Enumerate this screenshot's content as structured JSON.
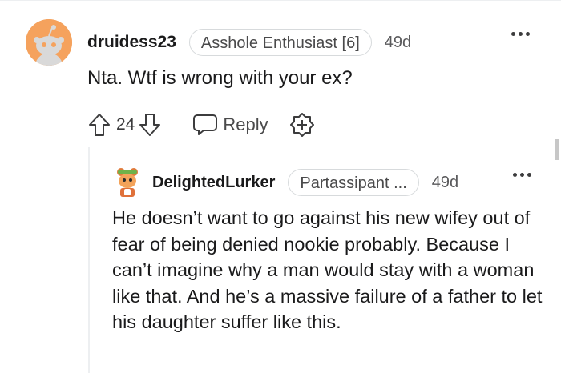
{
  "comments": [
    {
      "username": "druidess23",
      "flair": "Asshole Enthusiast [6]",
      "time": "49d",
      "body": "Nta. Wtf is wrong with your ex?",
      "votes": "24",
      "reply_label": "Reply",
      "avatar_color": "#f5a25d"
    },
    {
      "username": "DelightedLurker",
      "flair": "Partassipant ...",
      "time": "49d",
      "body": "He doesn’t want to go against his new wifey out of fear of being denied nookie probably. Because I can’t imagine why a man would stay with a woman like that. And he’s a massive failure of a father to let his daughter suffer like this."
    }
  ],
  "icons": {
    "upvote": "arrow-up-outline",
    "downvote": "arrow-down-outline",
    "reply": "speech-bubble",
    "award": "badge-plus",
    "more": "three-dots"
  }
}
